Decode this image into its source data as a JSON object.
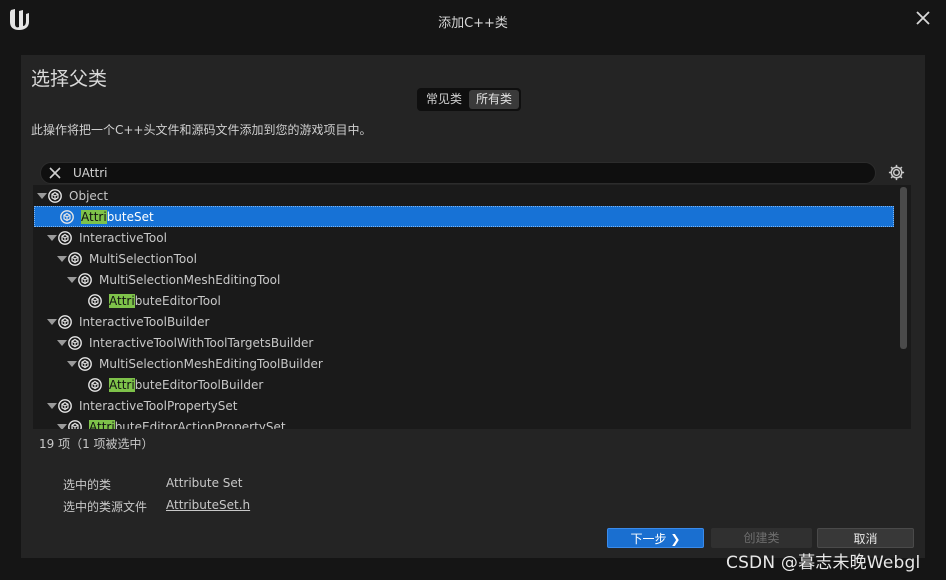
{
  "window": {
    "title": "添加C++类"
  },
  "heading": "选择父类",
  "tabs": [
    {
      "label": "常见类",
      "active": false
    },
    {
      "label": "所有类",
      "active": true
    }
  ],
  "description": "此操作将把一个C++头文件和源码文件添加到您的游戏项目中。",
  "search": {
    "value": "UAttri"
  },
  "tree": [
    {
      "pre": "",
      "match": "",
      "post": "Object",
      "depth": 0,
      "expanded": true,
      "selected": false
    },
    {
      "pre": "",
      "match": "Attri",
      "post": "buteSet",
      "depth": 1,
      "expanded": false,
      "selected": true
    },
    {
      "pre": "",
      "match": "",
      "post": "InteractiveTool",
      "depth": 1,
      "expanded": true,
      "selected": false
    },
    {
      "pre": "",
      "match": "",
      "post": "MultiSelectionTool",
      "depth": 2,
      "expanded": true,
      "selected": false
    },
    {
      "pre": "",
      "match": "",
      "post": "MultiSelectionMeshEditingTool",
      "depth": 3,
      "expanded": true,
      "selected": false
    },
    {
      "pre": "",
      "match": "Attri",
      "post": "buteEditorTool",
      "depth": 4,
      "expanded": false,
      "selected": false
    },
    {
      "pre": "",
      "match": "",
      "post": "InteractiveToolBuilder",
      "depth": 1,
      "expanded": true,
      "selected": false
    },
    {
      "pre": "",
      "match": "",
      "post": "InteractiveToolWithToolTargetsBuilder",
      "depth": 2,
      "expanded": true,
      "selected": false
    },
    {
      "pre": "",
      "match": "",
      "post": "MultiSelectionMeshEditingToolBuilder",
      "depth": 3,
      "expanded": true,
      "selected": false
    },
    {
      "pre": "",
      "match": "Attri",
      "post": "buteEditorToolBuilder",
      "depth": 4,
      "expanded": false,
      "selected": false
    },
    {
      "pre": "",
      "match": "",
      "post": "InteractiveToolPropertySet",
      "depth": 1,
      "expanded": true,
      "selected": false
    },
    {
      "pre": "",
      "match": "Attri",
      "post": "buteEditorActionPropertySet",
      "depth": 2,
      "expanded": true,
      "selected": false
    }
  ],
  "count_text": "19 项（1 项被选中）",
  "selected_class": {
    "label": "选中的类",
    "value": "Attribute Set"
  },
  "selected_file": {
    "label": "选中的类源文件",
    "value": "AttributeSet.h"
  },
  "buttons": {
    "next": "下一步",
    "create": "创建类",
    "cancel": "取消"
  },
  "watermark": "CSDN @暮志未晚Webgl",
  "colors": {
    "accent": "#1a6fd0",
    "highlight": "#7ec24a",
    "panel": "#242424",
    "background": "#151515"
  },
  "icons": {
    "logo": "unreal-logo-icon",
    "close": "close-icon",
    "clear": "clear-x-icon",
    "settings": "gear-icon",
    "class": "class-icon",
    "next": "chevron-right-icon"
  }
}
